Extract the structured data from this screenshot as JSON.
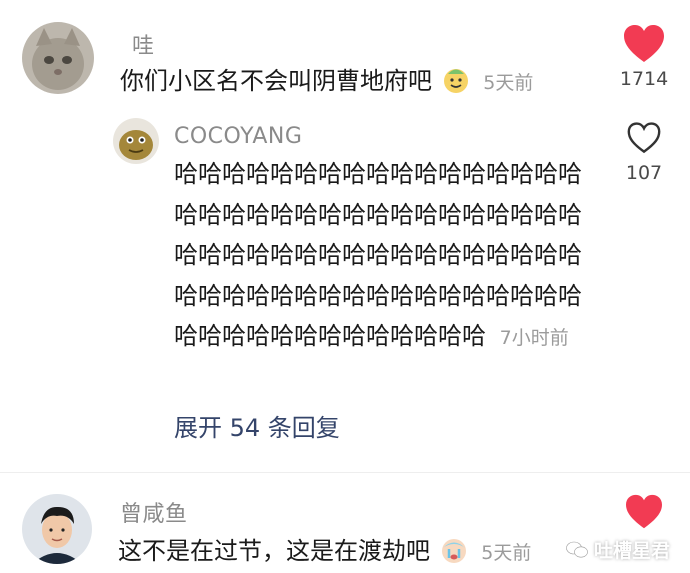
{
  "comments": [
    {
      "username": "哇",
      "text": "你们小区名不会叫阴曹地府吧",
      "time": "5天前",
      "likes": "1714",
      "liked": true,
      "replies": [
        {
          "username": "COCOYANG",
          "text": "哈哈哈哈哈哈哈哈哈哈哈哈哈哈哈哈哈哈哈哈哈哈哈哈哈哈哈哈哈哈哈哈哈哈哈哈哈哈哈哈哈哈哈哈哈哈哈哈哈哈哈哈哈哈哈哈哈哈哈哈哈哈哈哈哈哈哈哈哈哈哈哈哈哈哈哈哈哈哈哈哈",
          "time": "7小时前",
          "likes": "107",
          "liked": false
        }
      ],
      "expand_label": "展开 54 条回复"
    },
    {
      "username": "曾咸鱼",
      "text": "这不是在过节，这是在渡劫吧",
      "time": "5天前",
      "liked": true
    }
  ],
  "watermark": "吐槽星君",
  "colors": {
    "heart_liked": "#f23b53",
    "heart_outline": "#333333",
    "link": "#34446a"
  }
}
